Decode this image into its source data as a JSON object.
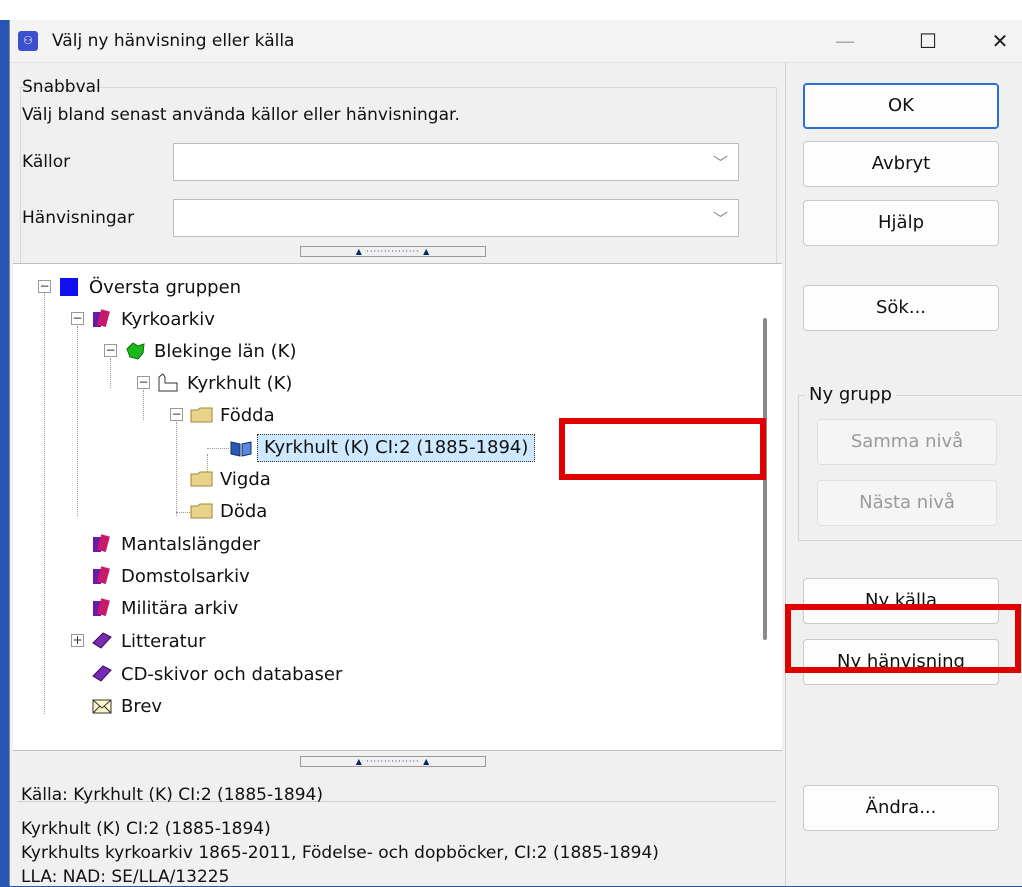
{
  "window": {
    "title": "Välj ny hänvisning eller källa"
  },
  "quick": {
    "group_label": "Snabbval",
    "hint": "Välj bland senast använda källor eller hänvisningar.",
    "sources_label": "Källor",
    "references_label": "Hänvisningar",
    "sources_value": "",
    "references_value": ""
  },
  "tree": {
    "root": "Översta gruppen",
    "kyrkoarkiv": "Kyrkoarkiv",
    "blekinge": "Blekinge län (K)",
    "kyrkhult": "Kyrkhult (K)",
    "fodda": "Födda",
    "selected": "Kyrkhult (K) CI:2 (1885-1894)",
    "vigda": "Vigda",
    "doda": "Döda",
    "mantal": "Mantalslängder",
    "domstol": "Domstolsarkiv",
    "militara": "Militära arkiv",
    "litteratur": "Litteratur",
    "cd": "CD-skivor och databaser",
    "brev": "Brev"
  },
  "info": {
    "title": "Källa: Kyrkhult (K) CI:2 (1885-1894)",
    "line1": "Kyrkhult (K) CI:2 (1885-1894)",
    "line2": "Kyrkhults kyrkoarkiv 1865-2011, Födelse- och dopböcker, CI:2 (1885-1894)",
    "line3": "LLA: NAD: SE/LLA/13225"
  },
  "buttons": {
    "ok": "OK",
    "cancel": "Avbryt",
    "help": "Hjälp",
    "search": "Sök...",
    "new_group": "Ny grupp",
    "same_level": "Samma nivå",
    "next_level": "Nästa nivå",
    "new_source": "Ny källa",
    "new_reference": "Ny hänvisning",
    "edit": "Ändra..."
  },
  "colors": {
    "highlight_box": "#e00000",
    "selection": "#cde8ff",
    "accent": "#2a6ed6"
  }
}
